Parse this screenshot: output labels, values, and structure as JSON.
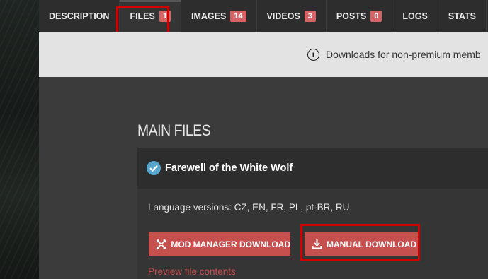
{
  "tabs": [
    {
      "label": "DESCRIPTION",
      "badge": null
    },
    {
      "label": "FILES",
      "badge": "1"
    },
    {
      "label": "IMAGES",
      "badge": "14"
    },
    {
      "label": "VIDEOS",
      "badge": "3"
    },
    {
      "label": "POSTS",
      "badge": "0"
    },
    {
      "label": "LOGS",
      "badge": null
    },
    {
      "label": "STATS",
      "badge": null
    }
  ],
  "notice": {
    "text": "Downloads for non-premium memb",
    "icon": "info-icon"
  },
  "main": {
    "section_title": "MAIN FILES",
    "file": {
      "title": "Farewell of the White Wolf",
      "language_versions": "Language versions: CZ, EN, FR, PL, pt-BR, RU",
      "mod_manager_button": "MOD MANAGER DOWNLOAD",
      "manual_button": "MANUAL DOWNLOAD",
      "preview_link": "Preview file contents"
    }
  },
  "colors": {
    "accent": "#c5504e",
    "badge": "#d66466",
    "highlight": "#d40000",
    "check": "#57a5cc"
  }
}
